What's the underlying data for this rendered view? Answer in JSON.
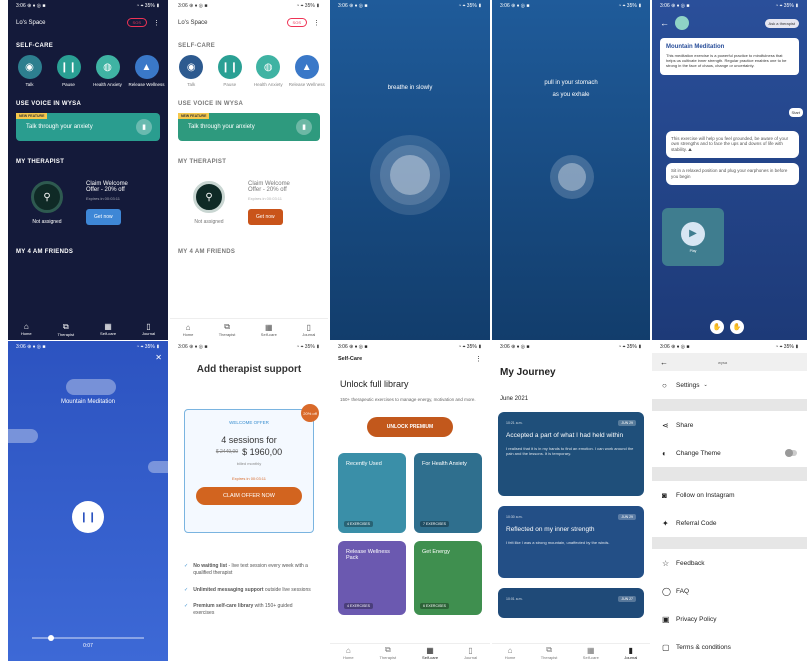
{
  "statusbar": {
    "left": "3:06 ⊕ ♦ ◎ ■",
    "right": "◔ ⌖ 35% ▮"
  },
  "home": {
    "greeting": "Lo's Space",
    "sos": "SOS",
    "self_care_title": "SELF-CARE",
    "care_items": [
      {
        "label": "Talk",
        "icon": "chat-bubble-icon"
      },
      {
        "label": "Pause",
        "icon": "pause-icon"
      },
      {
        "label": "Health Anxiety",
        "icon": "globe-icon"
      },
      {
        "label": "Release Wellness",
        "icon": "drop-icon"
      }
    ],
    "voice_title": "USE VOICE IN WYSA",
    "voice_tag": "NEW FEATURE",
    "voice_text": "Talk through your anxiety",
    "therapist_title": "MY THERAPIST",
    "offer_line1": "Claim Welcome",
    "offer_line2": "Offer - 20% off",
    "offer_expires": "Expires in 00:03:11",
    "not_assigned": "Not assigned",
    "get_now": "Get now",
    "friends_title": "MY 4 AM FRIENDS",
    "nav": [
      "Home",
      "Therapist",
      "Self-care",
      "Journal"
    ]
  },
  "breathe": {
    "text1": "breathe in slowly",
    "text2a": "pull in your stomach",
    "text2b": "as you exhale"
  },
  "meditation_chat": {
    "title": "Mountain Meditation",
    "body": "This meditation exercise is a powerful practice to mindfulness that helps us cultivate inner strength. Regular practice enables one to be strong in the face of chaos, change or uncertainty.",
    "start": "Start",
    "msg1": "This exercise will help you feel grounded, be aware of your own strengths and to face the ups and downs of life with stability. ⛰",
    "msg2": "Sit in a relaxed position and plug your earphones in before you begin",
    "play_label": "Play",
    "top_pill": "Ask a therapist"
  },
  "player": {
    "title": "Mountain Meditation",
    "time": "0:07"
  },
  "offer": {
    "title": "Add therapist support",
    "badge": "20% off",
    "tier": "WELCOME OFFER",
    "sessions": "4 sessions for",
    "old_price": "$ 2449,00",
    "new_price": "$ 1960,00",
    "billed": "billed monthly",
    "expires": "Expires in 00:03:11",
    "cta": "CLAIM OFFER NOW",
    "features": [
      {
        "bold": "No waiting list",
        "rest": " - live text session every week with a qualified therapist"
      },
      {
        "bold": "Unlimited messaging support",
        "rest": " outside live sessions"
      },
      {
        "bold": "Premium self-care library",
        "rest": " with 150+ guided exercises"
      }
    ]
  },
  "library": {
    "header": "Self-Care",
    "unlock_title": "Unlock full library",
    "unlock_sub": "150+ therapeutic exercises to manage energy, motivation and more.",
    "cta": "UNLOCK PREMIUM",
    "tiles": [
      {
        "title": "Recently Used",
        "count": "4 EXERCISES",
        "color": "#3a8fa8"
      },
      {
        "title": "For Health Anxiety",
        "count": "7 EXERCISES",
        "color": "#2f6f8e"
      },
      {
        "title": "Release Wellness Pack",
        "count": "4 EXERCISES",
        "color": "#6b59b0"
      },
      {
        "title": "Get Energy",
        "count": "6 EXERCISES",
        "color": "#3f8f4f"
      }
    ],
    "nav": [
      "Home",
      "Therapist",
      "Self-care",
      "Journal"
    ]
  },
  "journey": {
    "title": "My Journey",
    "month": "June 2021",
    "entries": [
      {
        "time": "10:21 a.m.",
        "tag": "JUN 29",
        "title": "Accepted a part of what I had held within",
        "body": "I realised that it is in my hands to find an emotion. I can work around the pain and the lessons. It is temporary."
      },
      {
        "time": "10:30 a.m.",
        "tag": "JUN 29",
        "title": "Reflected on my inner strength",
        "body": "I felt like I was a strong mountain, unaffected by the winds."
      },
      {
        "time": "10:01 a.m.",
        "tag": "JUN 27",
        "title": "",
        "body": ""
      }
    ],
    "nav": [
      "Home",
      "Therapist",
      "Self-care",
      "Journal"
    ]
  },
  "settings": {
    "header": "wysa",
    "items": [
      {
        "label": "Settings",
        "icon": "circle-icon",
        "group": 1
      },
      {
        "label": "Share",
        "icon": "share-icon",
        "group": 2
      },
      {
        "label": "Change Theme",
        "icon": "theme-icon",
        "group": 2
      },
      {
        "label": "Follow on Instagram",
        "icon": "instagram-icon",
        "group": 3
      },
      {
        "label": "Referral Code",
        "icon": "gift-icon",
        "group": 3
      },
      {
        "label": "Feedback",
        "icon": "star-icon",
        "group": 4
      },
      {
        "label": "FAQ",
        "icon": "question-icon",
        "group": 4
      },
      {
        "label": "Privacy Policy",
        "icon": "lock-icon",
        "group": 4
      },
      {
        "label": "Terms & conditions",
        "icon": "document-icon",
        "group": 4
      }
    ]
  }
}
